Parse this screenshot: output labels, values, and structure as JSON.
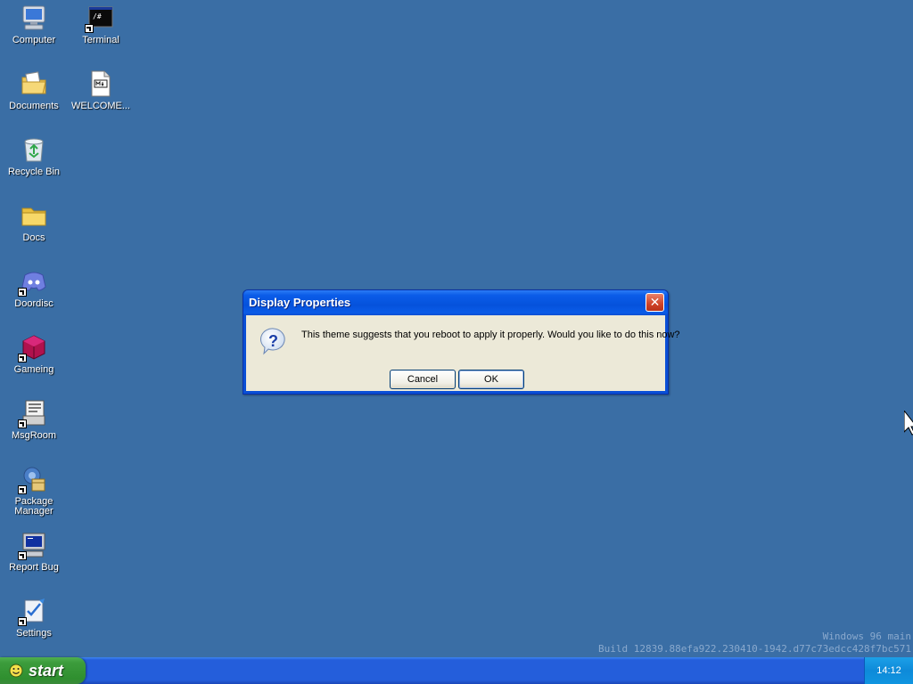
{
  "desktop": {
    "icons": [
      {
        "label": "Computer",
        "icon": "computer-icon"
      },
      {
        "label": "Documents",
        "icon": "documents-icon"
      },
      {
        "label": "Recycle Bin",
        "icon": "recycle-bin-icon"
      },
      {
        "label": "Docs",
        "icon": "folder-icon"
      },
      {
        "label": "Doordisc",
        "icon": "doordisc-icon"
      },
      {
        "label": "Gameing",
        "icon": "gameing-icon"
      },
      {
        "label": "MsgRoom",
        "icon": "msgroom-icon"
      },
      {
        "label": "Package\nManager",
        "icon": "package-manager-icon"
      },
      {
        "label": "Report Bug",
        "icon": "report-bug-icon"
      },
      {
        "label": "Settings",
        "icon": "settings-icon"
      },
      {
        "label": "Terminal",
        "icon": "terminal-icon"
      },
      {
        "label": "WELCOME...",
        "icon": "markdown-file-icon"
      }
    ]
  },
  "dialog": {
    "title": "Display Properties",
    "close_label": "✕",
    "message": "This theme suggests that you reboot to apply it properly. Would you like to do this now?",
    "cancel_label": "Cancel",
    "ok_label": "OK"
  },
  "watermark": {
    "line1": "Windows 96 main",
    "line2": "Build 12839.88efa922.230410-1942.d77c73edcc428f7bc571"
  },
  "taskbar": {
    "start_label": "start",
    "clock": "14:12"
  },
  "colors": {
    "desktop": "#3a6ea5",
    "titlebar": "#0552dc",
    "taskbar": "#245edb",
    "start": "#2f8f2f",
    "tray": "#0e8ad9"
  }
}
